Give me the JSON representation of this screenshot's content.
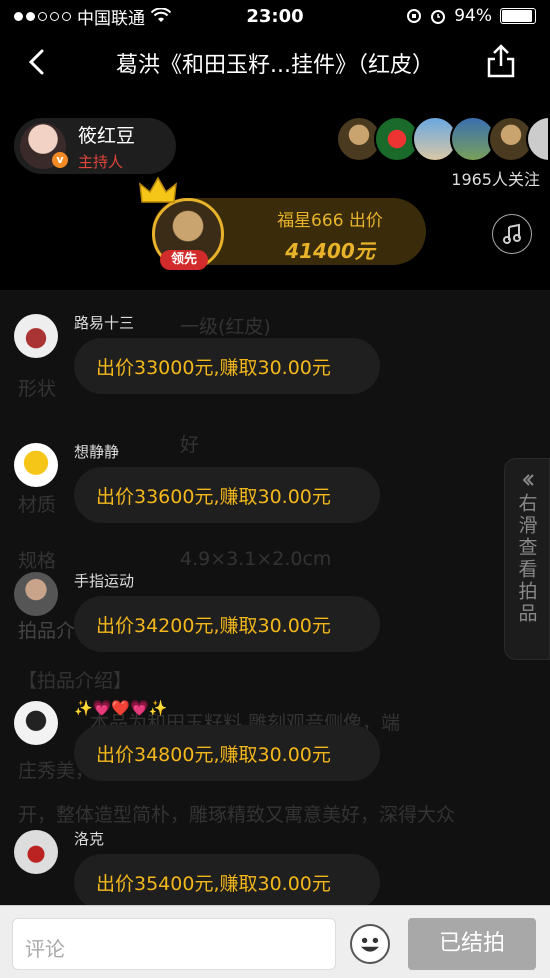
{
  "status_bar": {
    "carrier": "●●○○○ 中国联通",
    "carrier_text": "中国联通",
    "time": "23:00",
    "battery": "94%"
  },
  "nav": {
    "title": "葛洪《和田玉籽...挂件》（红皮）"
  },
  "host": {
    "name": "筱红豆",
    "role": "主持人"
  },
  "followers": {
    "count_text": "1965人关注"
  },
  "top_bid": {
    "bidder_line": "福星666 出价",
    "amount": "41400元",
    "lead_badge": "领先"
  },
  "background_text": {
    "row1": "一级(红皮)",
    "label2": "形状",
    "row2": "好",
    "label3": "材质",
    "label4": "规格",
    "row4": "4.9×3.1×2.0cm",
    "label5": "拍品介",
    "intro_title": "【拍品介绍】",
    "intro_line1": "本品为和田玉籽料 雕刻观音侧像，端",
    "intro_line2": "庄秀美，                         一侧俏色莲花自",
    "intro_line3": "开，整体造型简朴，雕琢精致又寓意美好，深得大众"
  },
  "side_tab": {
    "label": "右滑查看拍品"
  },
  "messages": [
    {
      "user": "路易十三",
      "text": "出价33000元,赚取30.00元"
    },
    {
      "user": "想静静",
      "text": "出价33600元,赚取30.00元"
    },
    {
      "user": "手指运动",
      "text": "出价34200元,赚取30.00元"
    },
    {
      "user": "✨💗❤️💗✨",
      "text": "出价34800元,赚取30.00元"
    },
    {
      "user": "洛克",
      "text": "出价35400元,赚取30.00元"
    }
  ],
  "footer": {
    "comment_placeholder": "评论",
    "ended_label": "已结拍"
  },
  "colors": {
    "bid_gold": "#f3b71c",
    "host_role_red": "#e0463c",
    "lead_red": "#d22b2b"
  }
}
